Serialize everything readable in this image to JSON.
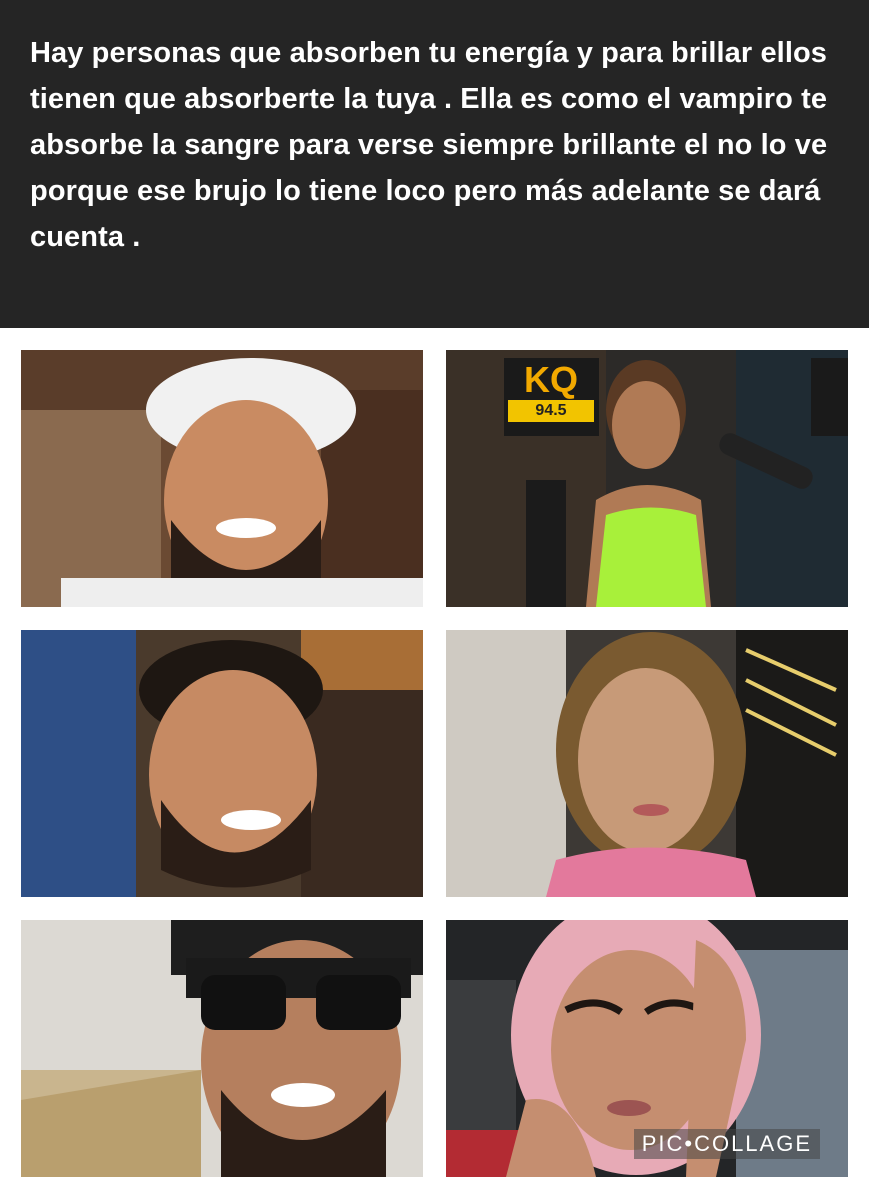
{
  "post": {
    "caption": "Hay personas que absorben tu energía y para brillar ellos tienen que absorberte la tuya . Ella es como el vampiro te absorbe la sangre para verse siempre brillante el no lo ve porque ese brujo lo tiene loco pero más adelante se dará cuenta ."
  },
  "collage": {
    "watermark": "PIC•COLLAGE",
    "photos": [
      {
        "name": "man-smiling-white-cap",
        "sign_text": ""
      },
      {
        "name": "woman-smiling-radio-studio",
        "sign_text": "KQ",
        "sign_subtext": "94.5"
      },
      {
        "name": "man-smiling-short-hair",
        "sign_text": ""
      },
      {
        "name": "woman-selfie-blonde-hair",
        "sign_text": ""
      },
      {
        "name": "man-sunglasses-black-cap",
        "sign_text": ""
      },
      {
        "name": "woman-pink-hair",
        "sign_text": ""
      }
    ]
  }
}
